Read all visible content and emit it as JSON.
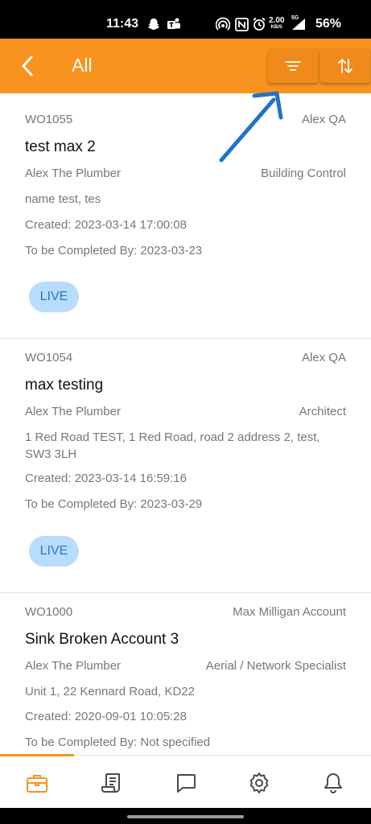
{
  "status_bar": {
    "time": "11:43",
    "speed_value": "2.00",
    "speed_unit": "KB/S",
    "network": "5G",
    "battery": "56%",
    "icons": [
      "snapchat-icon",
      "teams-icon",
      "hotspot-icon",
      "nfc-icon",
      "alarm-icon",
      "signal-icon"
    ]
  },
  "app_bar": {
    "title": "All",
    "back_icon": "back-arrow-icon",
    "filter_icon": "filter-icon",
    "sort_icon": "sort-icon",
    "background": "#f7931e"
  },
  "work_orders": [
    {
      "id": "WO1055",
      "account": "Alex QA",
      "title": "test max 2",
      "contractor": "Alex The Plumber",
      "trade": "Building Control",
      "address": "name test, tes",
      "created": "Created: 2023-03-14 17:00:08",
      "complete_by": "To be Completed By: 2023-03-23",
      "status": "LIVE"
    },
    {
      "id": "WO1054",
      "account": "Alex QA",
      "title": "max testing",
      "contractor": "Alex The Plumber",
      "trade": "Architect",
      "address": "1 Red Road TEST, 1 Red Road, road 2 address 2, test, SW3 3LH",
      "created": "Created: 2023-03-14 16:59:16",
      "complete_by": "To be Completed By: 2023-03-29",
      "status": "LIVE"
    },
    {
      "id": "WO1000",
      "account": "Max Milligan Account",
      "title": "Sink Broken Account 3",
      "contractor": "Alex The Plumber",
      "trade": "Aerial / Network Specialist",
      "address": "Unit 1, 22 Kennard Road, KD22",
      "created": "Created: 2020-09-01 10:05:28",
      "complete_by": "To be Completed By: Not specified"
    }
  ],
  "annotation": {
    "arrow_color": "#1e74c9"
  },
  "bottom_nav": {
    "items": [
      "briefcase-icon",
      "document-icon",
      "chat-icon",
      "settings-icon",
      "bell-icon"
    ],
    "active_color": "#f7931e",
    "inactive_color": "#4a4a4a"
  }
}
